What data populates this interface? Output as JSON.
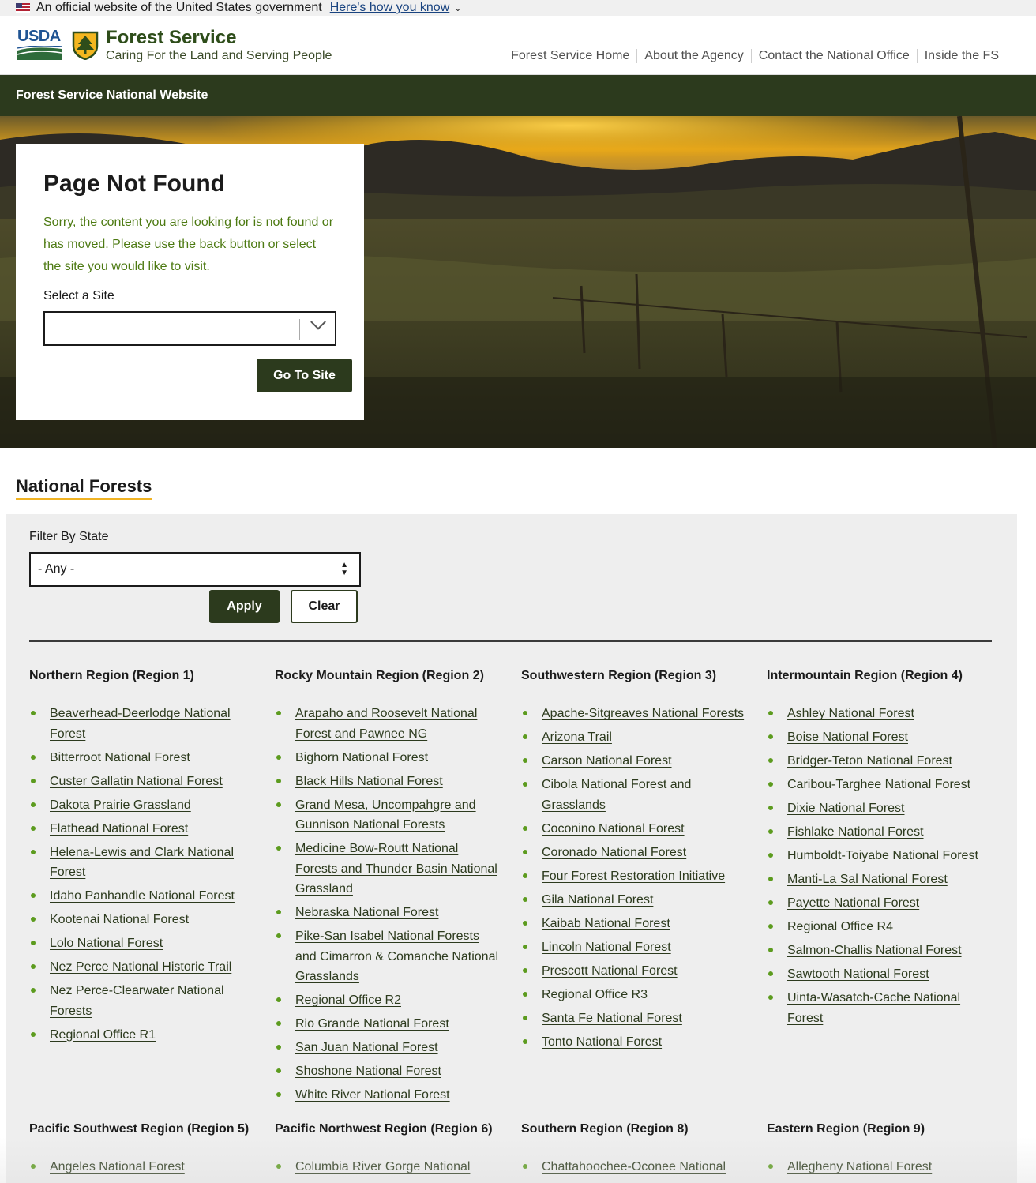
{
  "gov_banner": {
    "text": "An official website of the United States government",
    "link": "Here's how you know"
  },
  "header": {
    "logo_text": "USDA",
    "agency_title": "Forest Service",
    "tagline": "Caring For the Land and Serving People",
    "nav": [
      "Forest Service Home",
      "About the Agency",
      "Contact the National Office",
      "Inside the FS"
    ]
  },
  "site_bar": {
    "title": "Forest Service National Website"
  },
  "not_found": {
    "heading": "Page Not Found",
    "message": "Sorry, the content you are looking for is not found or has moved. Please use the back button or select the site you would like to visit.",
    "select_label": "Select a Site",
    "select_value": "",
    "button": "Go To Site"
  },
  "national_forests": {
    "heading": "National Forests",
    "filter_label": "Filter By State",
    "filter_value": "- Any -",
    "apply": "Apply",
    "clear": "Clear",
    "regions": [
      {
        "title": "Northern Region (Region 1)",
        "items": [
          "Beaverhead-Deerlodge National Forest",
          "Bitterroot National Forest",
          "Custer Gallatin National Forest",
          "Dakota Prairie Grassland",
          "Flathead National Forest",
          "Helena-Lewis and Clark National Forest",
          "Idaho Panhandle National Forest",
          "Kootenai National Forest",
          "Lolo National Forest",
          "Nez Perce National Historic Trail",
          "Nez Perce-Clearwater National Forests",
          "Regional Office R1"
        ]
      },
      {
        "title": "Rocky Mountain Region (Region 2)",
        "items": [
          "Arapaho and Roosevelt National Forest and Pawnee NG",
          "Bighorn National Forest",
          "Black Hills National Forest",
          "Grand Mesa, Uncompahgre and Gunnison National Forests",
          "Medicine Bow-Routt National Forests and Thunder Basin National Grassland",
          "Nebraska National Forest",
          "Pike-San Isabel National Forests and Cimarron & Comanche National Grasslands",
          "Regional Office R2",
          "Rio Grande National Forest",
          "San Juan National Forest",
          "Shoshone National Forest",
          "White River National Forest"
        ]
      },
      {
        "title": "Southwestern Region (Region 3)",
        "items": [
          "Apache-Sitgreaves National Forests",
          "Arizona Trail",
          "Carson National Forest",
          "Cibola National Forest and Grasslands",
          "Coconino National Forest",
          "Coronado National Forest",
          "Four Forest Restoration Initiative",
          "Gila National Forest",
          "Kaibab National Forest",
          "Lincoln National Forest",
          "Prescott National Forest",
          "Regional Office R3",
          "Santa Fe National Forest",
          "Tonto National Forest"
        ]
      },
      {
        "title": "Intermountain Region (Region 4)",
        "items": [
          "Ashley National Forest",
          "Boise National Forest",
          "Bridger-Teton National Forest",
          "Caribou-Targhee National Forest",
          "Dixie National Forest",
          "Fishlake National Forest",
          "Humboldt-Toiyabe National Forest",
          "Manti-La Sal National Forest",
          "Payette National Forest",
          "Regional Office R4",
          "Salmon-Challis National Forest",
          "Sawtooth National Forest",
          "Uinta-Wasatch-Cache National Forest"
        ]
      },
      {
        "title": "Pacific Southwest Region (Region 5)",
        "items": [
          "Angeles National Forest"
        ]
      },
      {
        "title": "Pacific Northwest Region (Region 6)",
        "items": [
          "Columbia River Gorge National"
        ]
      },
      {
        "title": "Southern Region (Region 8)",
        "items": [
          "Chattahoochee-Oconee National"
        ]
      },
      {
        "title": "Eastern Region (Region 9)",
        "items": [
          "Allegheny National Forest"
        ]
      }
    ]
  },
  "colors": {
    "brand_dark_green": "#2c3a1d",
    "message_green": "#4d7a12",
    "bullet_green": "#5c9b1e",
    "heading_underline": "#f0b323"
  }
}
